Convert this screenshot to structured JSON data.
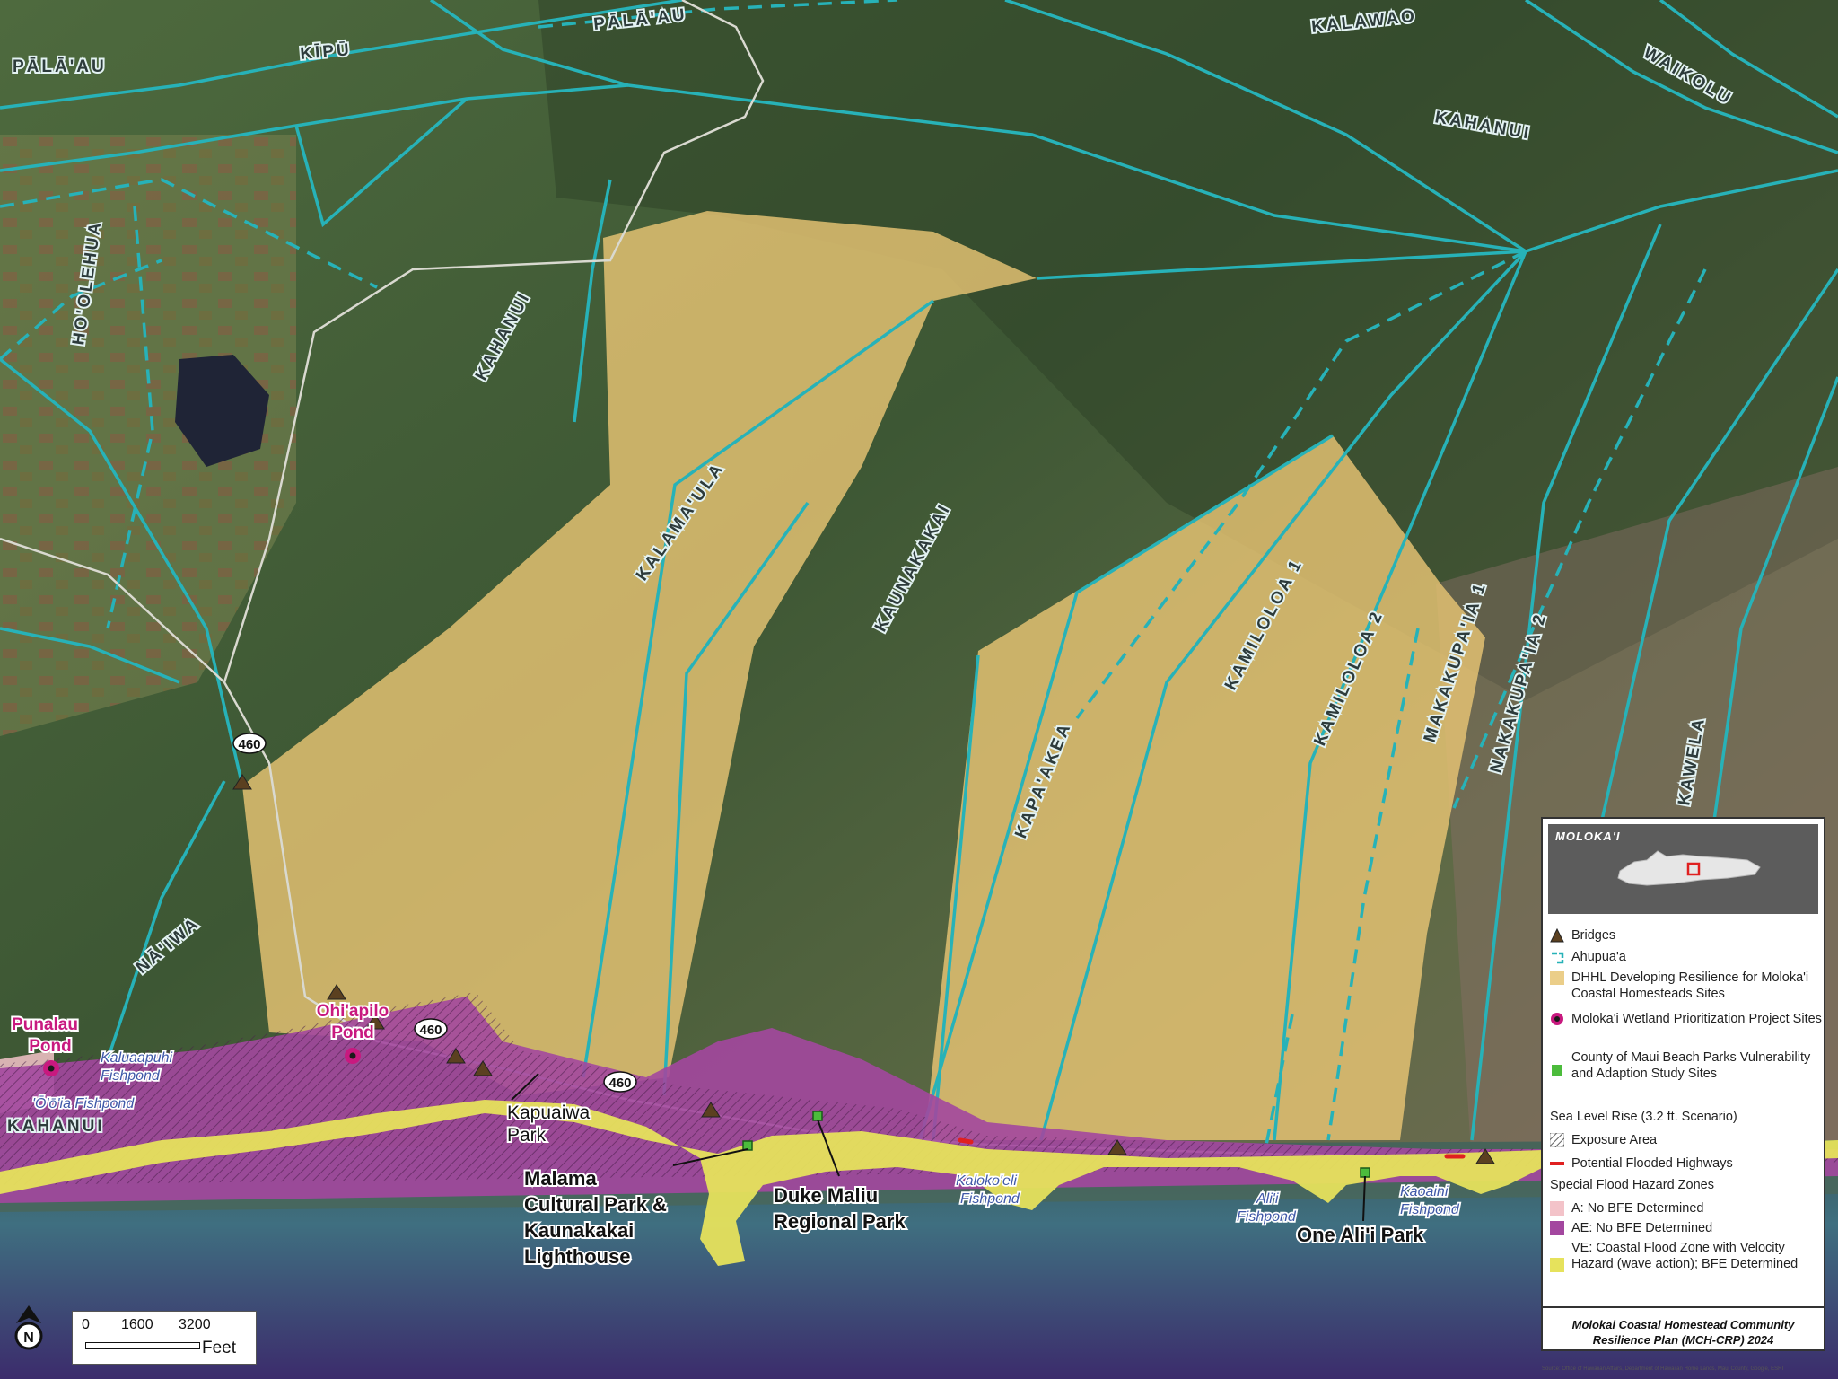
{
  "map": {
    "ahupuaa_labels": [
      "PĀLĀ'AU",
      "PĀLĀ'AU",
      "KĪPŪ",
      "KALAWAO",
      "WAIKOLU",
      "KAHANUI",
      "HO'OLEHUA",
      "KAHANUI",
      "KALAMA'ULA",
      "KAUNAKAKAI",
      "KAMILOLOA 1",
      "KAMILOLOA 2",
      "MAKAKUPA'IA 1",
      "KAPA'AKEA",
      "NAKAKUPA'IA 2",
      "KAWELA",
      "NĀ'IWA",
      "KAHANUI"
    ],
    "route_number": "460",
    "places": {
      "kapuaiwa": [
        "Kapuaiwa",
        "Park"
      ],
      "malama": [
        "Malama",
        "Cultural Park &",
        "Kaunakakai",
        "Lighthouse"
      ],
      "duke": [
        "Duke Maliu",
        "Regional Park"
      ],
      "onealii": "One Ali'i Park"
    },
    "wetlands": {
      "punalau": [
        "Punalau",
        "Pond"
      ],
      "ohiapilo": [
        "Ohi'apilo",
        "Pond"
      ]
    },
    "fishponds": {
      "kaluaapuhi": [
        "Kaluaapuhi",
        "Fishpond"
      ],
      "ooia": "'Ō'ō'ia Fishpond",
      "kalokoeli": [
        "Kaloko'eli",
        "Fishpond"
      ],
      "alii": [
        "Ali'i",
        "Fishpond"
      ],
      "kaoaini": [
        "Kaoaini",
        "Fishpond"
      ]
    }
  },
  "legend": {
    "inset_title": "MOLOKA'I",
    "items": {
      "bridges": "Bridges",
      "ahupuaa": "Ahupua'a",
      "dhhl": "DHHL Developing Resilience for Moloka'i Coastal Homesteads Sites",
      "wetland": "Moloka'i Wetland Prioritization Project Sites",
      "parks": "County of Maui Beach Parks Vulnerability and Adaption Study Sites"
    },
    "slr_heading": "Sea Level Rise (3.2 ft. Scenario)",
    "exposure": "Exposure Area",
    "flooded_highways": "Potential Flooded Highways",
    "flood_heading": "Special Flood Hazard Zones",
    "zone_a": "A: No BFE Determined",
    "zone_ae": "AE: No BFE Determined",
    "zone_ve": "VE: Coastal Flood Zone with Velocity Hazard (wave action); BFE Determined",
    "plan_title": "Molokai Coastal Homestead Community Resilience Plan (MCH-CRP) 2024",
    "source": "Source: Office of Hawaiian Affairs, Department of Hawaiian Home Lands, Maui County, Google, ESRI"
  },
  "scalebar": {
    "ticks": [
      "0",
      "1600",
      "3200"
    ],
    "unit": "Feet"
  },
  "colors": {
    "dhhl": "#e8c574",
    "ae": "#a3479f",
    "ve": "#e6e25c",
    "zone_a": "#f3c3c9",
    "ahupuaa": "#27b2b8",
    "bridge": "#5b4020",
    "wetland": "#c8197f",
    "park": "#4cbc3c",
    "flooded_hwy": "#e02020"
  }
}
